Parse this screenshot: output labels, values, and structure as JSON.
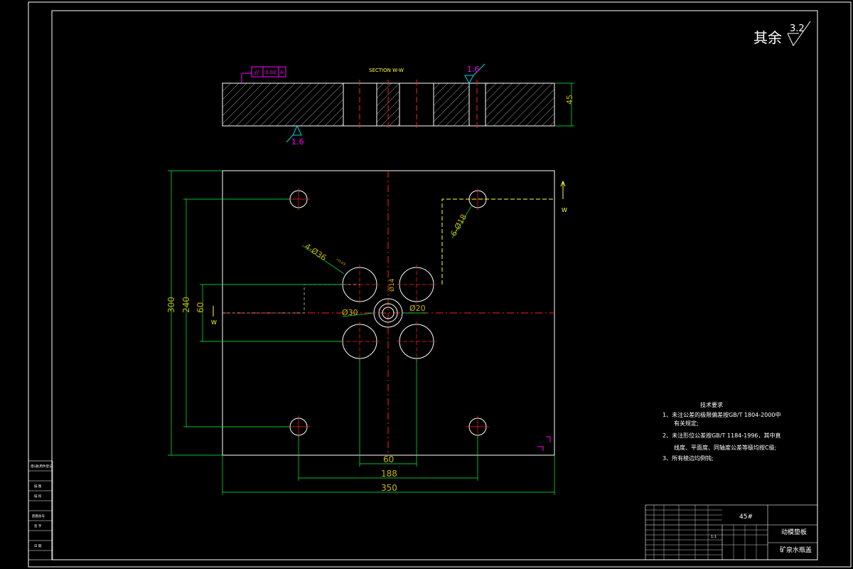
{
  "roughness": {
    "label": "其余",
    "value": "3.2"
  },
  "section": {
    "title": "SECTION W-W",
    "flatness_tol": "0.02",
    "flatness_datum": "A",
    "roughness_top": "1.6",
    "roughness_bottom": "1.6",
    "thickness": "45"
  },
  "plan": {
    "dims": {
      "height_300": "300",
      "height_240": "240",
      "height_60": "60",
      "width_350": "350",
      "width_188": "188",
      "width_60": "60"
    },
    "callouts": {
      "holes_36": "4-Ø36",
      "holes_36_tol_upper": "+0.03",
      "holes_36_tol_lower": "0",
      "holes_18": "6-Ø18",
      "dia_30": "Ø30",
      "dia_20": "Ø20",
      "dia_14": "Ø14"
    },
    "section_marks": [
      "W",
      "W"
    ]
  },
  "notes": {
    "title": "技术要求",
    "items": [
      "1、未注公差的极限偏差按GB/T 1804-2000中",
      "有关规定;",
      "2、未注形位公差按GB/T 1184-1996，其中直",
      "线度、平面度、同轴度公差等级均按C级;",
      "3、所有棱边均倒钝;"
    ]
  },
  "title_block": {
    "material": "45#",
    "part_name": "动模垫板",
    "company": "矿泉水瓶盖",
    "scale": "1:1"
  },
  "side_column": {
    "items": [
      "借(通)用件登记",
      "描 图",
      "描 校",
      "底图总号",
      "签 字",
      "日 期"
    ]
  }
}
